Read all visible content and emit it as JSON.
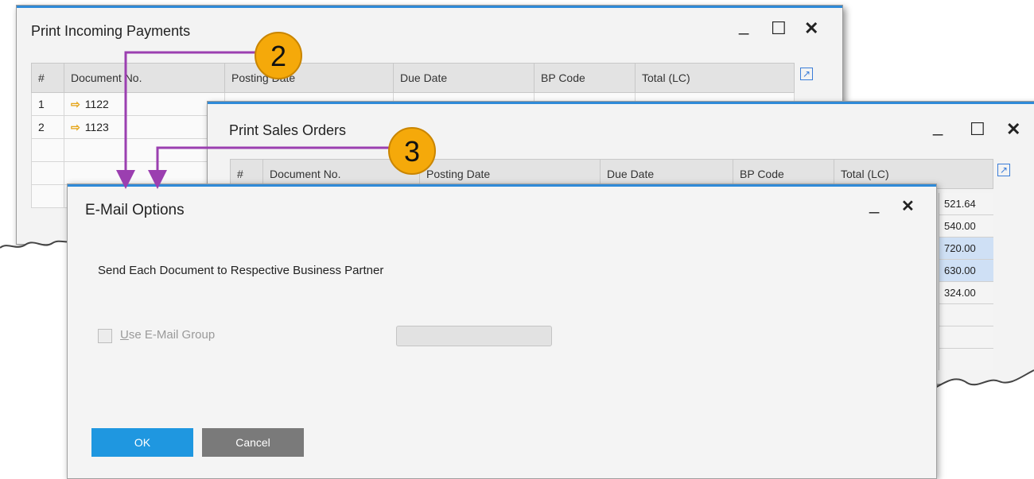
{
  "incoming_payments": {
    "title": "Print Incoming Payments",
    "columns": [
      "#",
      "Document No.",
      "Posting Date",
      "Due Date",
      "BP Code",
      "Total (LC)"
    ],
    "rows": [
      {
        "num": "1",
        "doc": "1122"
      },
      {
        "num": "2",
        "doc": "1123"
      }
    ]
  },
  "sales_orders": {
    "title": "Print Sales Orders",
    "columns": [
      "#",
      "Document No.",
      "Posting Date",
      "Due Date",
      "BP Code",
      "Total (LC)"
    ],
    "totals": [
      "521.64",
      "540.00",
      "720.00",
      "630.00",
      "324.00"
    ]
  },
  "window_controls": {
    "minimize": "_",
    "maximize": "☐",
    "close": "✕"
  },
  "callouts": {
    "two": "2",
    "three": "3"
  },
  "email_options": {
    "title": "E-Mail Options",
    "send_label": "Send Each Document to Respective Business Partner",
    "use_group_label_u": "U",
    "use_group_label_rest": "se E-Mail Group",
    "ok": "OK",
    "cancel": "Cancel"
  },
  "colors": {
    "accent": "#2f8ad8",
    "callout": "#f5a90a",
    "connector": "#9b3fb0",
    "ok_button": "#1f97e0"
  }
}
